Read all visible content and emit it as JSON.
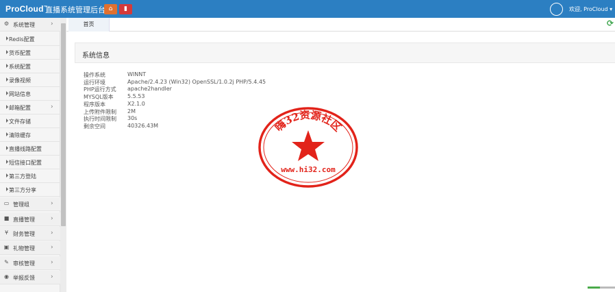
{
  "header": {
    "brand": "ProCloud",
    "brand_tm": "™",
    "subtitle": "直播系统管理后台",
    "home_icon": "home-icon",
    "delete_icon": "trash-icon",
    "welcome": "欢迎, ProCloud ▾",
    "accent": "#2c7fc2"
  },
  "sidebar": {
    "items": [
      {
        "label": "系统管理",
        "icon": "cogs-icon",
        "glyph": "⚙",
        "chev": "›"
      },
      {
        "label": "Redis配置"
      },
      {
        "label": "货币配置"
      },
      {
        "label": "系统配置"
      },
      {
        "label": "录像视频"
      },
      {
        "label": "网站信息"
      },
      {
        "label": "邮箱配置",
        "chev": "›"
      },
      {
        "label": "文件存储"
      },
      {
        "label": "清除缓存"
      },
      {
        "label": "直播线路配置"
      },
      {
        "label": "短信接口配置"
      },
      {
        "label": "第三方登陆"
      },
      {
        "label": "第三方分享"
      },
      {
        "label": "管理组",
        "icon": "desktop-icon",
        "glyph": "▭",
        "chev": "›"
      },
      {
        "label": "直播管理",
        "icon": "video-icon",
        "glyph": "■",
        "chev": "›"
      },
      {
        "label": "财务管理",
        "icon": "yen-icon",
        "glyph": "¥",
        "chev": "›"
      },
      {
        "label": "礼物管理",
        "icon": "gift-icon",
        "glyph": "▣",
        "chev": "›"
      },
      {
        "label": "审核管理",
        "icon": "edit-icon",
        "glyph": "✎",
        "chev": "›"
      },
      {
        "label": "举报反馈",
        "icon": "comments-icon",
        "glyph": "◉",
        "chev": "›"
      }
    ]
  },
  "tabs": [
    {
      "label": "首页"
    }
  ],
  "refresh_icon": "refresh-icon",
  "panel": {
    "title": "系统信息",
    "rows": [
      {
        "key": "操作系统",
        "value": "WINNT"
      },
      {
        "key": "运行环境",
        "value": "Apache/2.4.23 (Win32) OpenSSL/1.0.2j PHP/5.4.45"
      },
      {
        "key": "PHP运行方式",
        "value": "apache2handler"
      },
      {
        "key": "MYSQL版本",
        "value": "5.5.53"
      },
      {
        "key": "程序版本",
        "value": "X2.1.0"
      },
      {
        "key": "上传附件限制",
        "value": "2M"
      },
      {
        "key": "执行时间限制",
        "value": "30s"
      },
      {
        "key": "剩余空间",
        "value": "40326.43M"
      }
    ]
  },
  "stamp": {
    "text": "嗨32资源社区",
    "url": "www.hi32.com",
    "color": "#e2231a"
  }
}
